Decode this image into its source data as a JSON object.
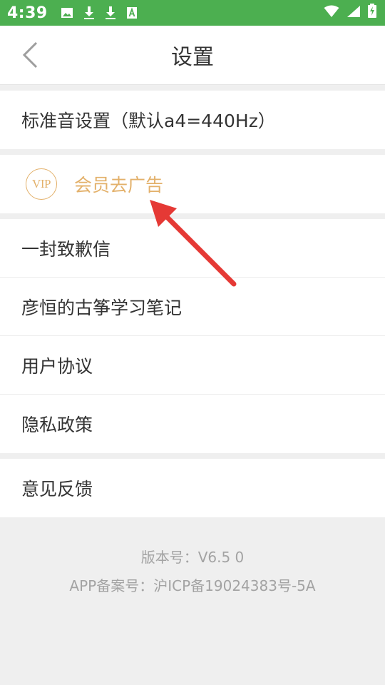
{
  "status": {
    "time": "4:39"
  },
  "header": {
    "title": "设置"
  },
  "rows": {
    "tuning": "标准音设置（默认a4=440Hz）",
    "vip_badge": "VIP",
    "vip_label": "会员去广告",
    "apology": "一封致歉信",
    "notes": "彦恒的古筝学习笔记",
    "agreement": "用户协议",
    "privacy": "隐私政策",
    "feedback": "意见反馈"
  },
  "footer": {
    "version": "版本号：V6.5  0",
    "filing": "APP备案号：沪ICP备19024383号-5A"
  },
  "colors": {
    "status_bar": "#4caf50",
    "vip_gold": "#e3b16b",
    "arrow": "#e53935"
  }
}
